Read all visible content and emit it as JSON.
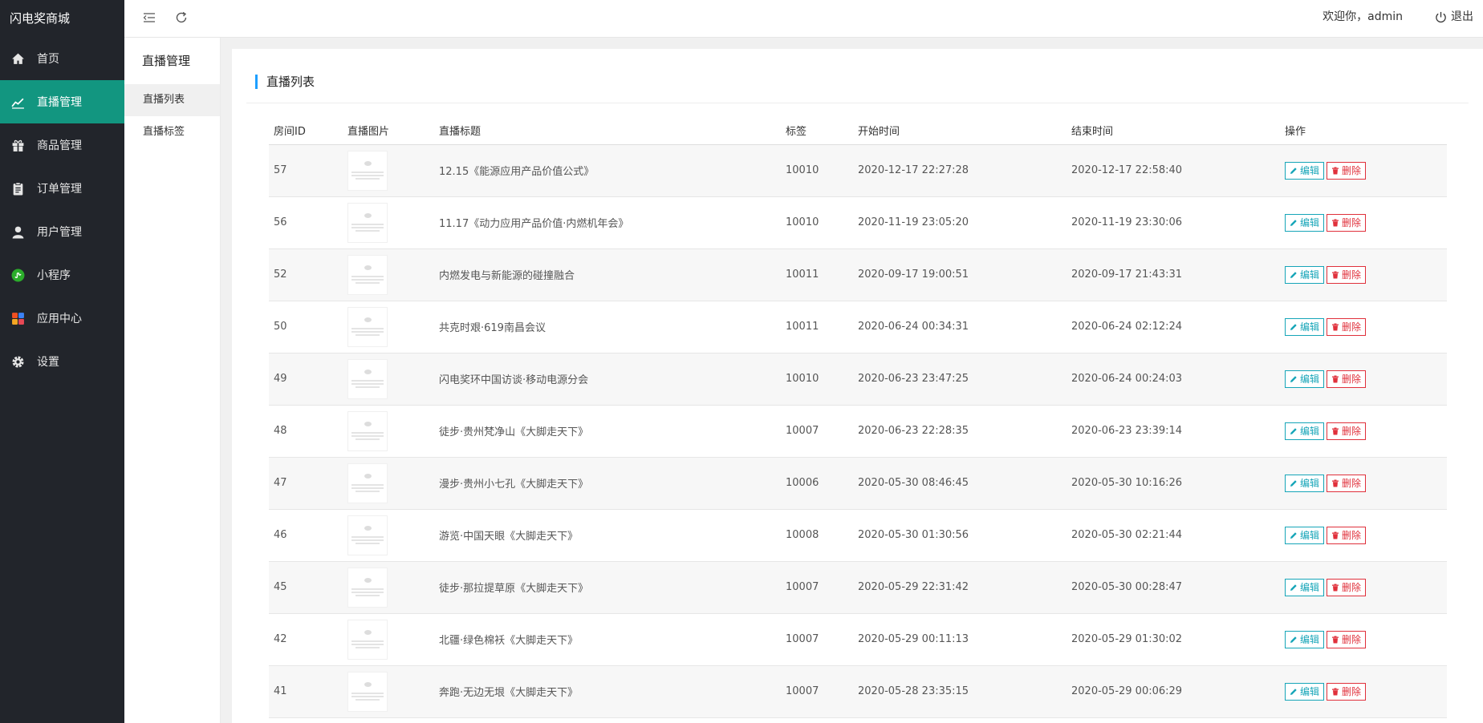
{
  "app": {
    "logo": "闪电奖商城"
  },
  "sidebar": {
    "items": [
      {
        "label": "首页",
        "icon": "home-icon"
      },
      {
        "label": "直播管理",
        "icon": "chart-line-icon",
        "active": true
      },
      {
        "label": "商品管理",
        "icon": "gift-icon"
      },
      {
        "label": "订单管理",
        "icon": "clipboard-icon"
      },
      {
        "label": "用户管理",
        "icon": "user-icon"
      },
      {
        "label": "小程序",
        "icon": "miniprogram-icon"
      },
      {
        "label": "应用中心",
        "icon": "apps-icon"
      },
      {
        "label": "设置",
        "icon": "gear-icon"
      }
    ]
  },
  "subnav": {
    "title": "直播管理",
    "items": [
      {
        "label": "直播列表",
        "active": true
      },
      {
        "label": "直播标签"
      }
    ]
  },
  "header": {
    "welcome": "欢迎你，admin",
    "logout": "退出"
  },
  "main": {
    "title": "直播列表",
    "columns": [
      "房间ID",
      "直播图片",
      "直播标题",
      "标签",
      "开始时间",
      "结束时间",
      "操作"
    ],
    "edit_label": "编辑",
    "delete_label": "删除",
    "rows": [
      {
        "id": "57",
        "title": "12.15《能源应用产品价值公式》",
        "tag": "10010",
        "start": "2020-12-17 22:27:28",
        "end": "2020-12-17 22:58:40"
      },
      {
        "id": "56",
        "title": "11.17《动力应用产品价值·内燃机年会》",
        "tag": "10010",
        "start": "2020-11-19 23:05:20",
        "end": "2020-11-19 23:30:06"
      },
      {
        "id": "52",
        "title": "内燃发电与新能源的碰撞融合",
        "tag": "10011",
        "start": "2020-09-17 19:00:51",
        "end": "2020-09-17 21:43:31"
      },
      {
        "id": "50",
        "title": "共克时艰·619南昌会议",
        "tag": "10011",
        "start": "2020-06-24 00:34:31",
        "end": "2020-06-24 02:12:24"
      },
      {
        "id": "49",
        "title": "闪电奖环中国访谈·移动电源分会",
        "tag": "10010",
        "start": "2020-06-23 23:47:25",
        "end": "2020-06-24 00:24:03"
      },
      {
        "id": "48",
        "title": "徒步·贵州梵净山《大脚走天下》",
        "tag": "10007",
        "start": "2020-06-23 22:28:35",
        "end": "2020-06-23 23:39:14"
      },
      {
        "id": "47",
        "title": "漫步·贵州小七孔《大脚走天下》",
        "tag": "10006",
        "start": "2020-05-30 08:46:45",
        "end": "2020-05-30 10:16:26"
      },
      {
        "id": "46",
        "title": "游览·中国天眼《大脚走天下》",
        "tag": "10008",
        "start": "2020-05-30 01:30:56",
        "end": "2020-05-30 02:21:44"
      },
      {
        "id": "45",
        "title": "徒步·那拉提草原《大脚走天下》",
        "tag": "10007",
        "start": "2020-05-29 22:31:42",
        "end": "2020-05-30 00:28:47"
      },
      {
        "id": "42",
        "title": "北疆·绿色棉袄《大脚走天下》",
        "tag": "10007",
        "start": "2020-05-29 00:11:13",
        "end": "2020-05-29 01:30:02"
      },
      {
        "id": "41",
        "title": "奔跑·无边无垠《大脚走天下》",
        "tag": "10007",
        "start": "2020-05-28 23:35:15",
        "end": "2020-05-29 00:06:29"
      }
    ]
  }
}
